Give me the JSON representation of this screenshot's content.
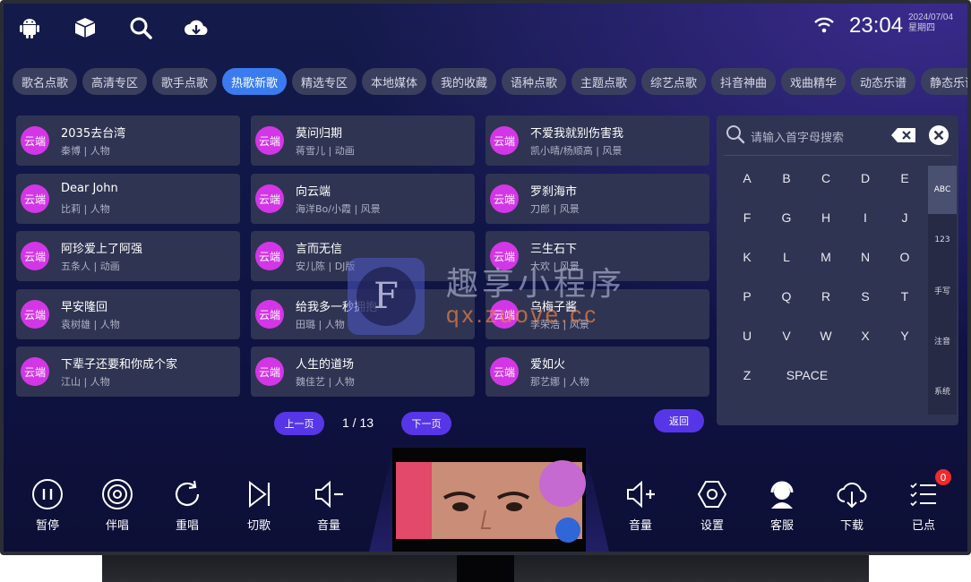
{
  "top_bar": {
    "icons": [
      "android-icon",
      "box-icon",
      "search-icon",
      "cloud-download-icon"
    ],
    "time": "23:04",
    "date_line1": "2024/07/04",
    "date_line2": "星期四"
  },
  "tabs": [
    "歌名点歌",
    "高清专区",
    "歌手点歌",
    "热歌新歌",
    "精选专区",
    "本地媒体",
    "我的收藏",
    "语种点歌",
    "主题点歌",
    "综艺点歌",
    "抖音神曲",
    "戏曲精华",
    "动态乐谱",
    "静态乐谱"
  ],
  "active_tab": "热歌新歌",
  "songs": [
    {
      "badge": "云端",
      "title": "2035去台湾",
      "sub": "秦博 | 人物"
    },
    {
      "badge": "云端",
      "title": "莫问归期",
      "sub": "蒋雪儿 | 动画"
    },
    {
      "badge": "云端",
      "title": "不爱我就别伤害我",
      "sub": "凯小晴/杨顺高 | 风景"
    },
    {
      "badge": "云端",
      "title": "Dear John",
      "sub": "比莉 | 人物"
    },
    {
      "badge": "云端",
      "title": "向云端",
      "sub": "海洋Bo/小霞 | 风景"
    },
    {
      "badge": "云端",
      "title": "罗刹海市",
      "sub": "刀郎 | 风景"
    },
    {
      "badge": "云端",
      "title": "阿珍爱上了阿强",
      "sub": "五条人 | 动画"
    },
    {
      "badge": "云端",
      "title": "言而无信",
      "sub": "安儿陈 | DJ版"
    },
    {
      "badge": "云端",
      "title": "三生石下",
      "sub": "大欢 | 风景"
    },
    {
      "badge": "云端",
      "title": "早安隆回",
      "sub": "袁树雄 | 人物"
    },
    {
      "badge": "云端",
      "title": "给我多一秒拥抱",
      "sub": "田璐 | 人物"
    },
    {
      "badge": "云端",
      "title": "乌梅子酱",
      "sub": "李荣浩 | 风景"
    },
    {
      "badge": "云端",
      "title": "下辈子还要和你成个家",
      "sub": "江山 | 人物"
    },
    {
      "badge": "云端",
      "title": "人生的道场",
      "sub": "魏佳艺 | 人物"
    },
    {
      "badge": "云端",
      "title": "爱如火",
      "sub": "那艺娜 | 人物"
    }
  ],
  "pagination": {
    "prev": "上一页",
    "indicator": "1 / 13",
    "next": "下一页",
    "back": "返回"
  },
  "keyboard": {
    "placeholder": "请输入首字母搜索",
    "keys": [
      "A",
      "B",
      "C",
      "D",
      "E",
      "F",
      "G",
      "H",
      "I",
      "J",
      "K",
      "L",
      "M",
      "N",
      "O",
      "P",
      "Q",
      "R",
      "S",
      "T",
      "U",
      "V",
      "W",
      "X",
      "Y",
      "Z"
    ],
    "space": "SPACE",
    "modes": [
      "ABC",
      "123",
      "手写",
      "注音",
      "系统"
    ],
    "active_mode": "ABC"
  },
  "controls_left": [
    {
      "icon": "pause-icon",
      "label": "暂停"
    },
    {
      "icon": "disc-icon",
      "label": "伴唱"
    },
    {
      "icon": "replay-icon",
      "label": "重唱"
    },
    {
      "icon": "skip-next-icon",
      "label": "切歌"
    },
    {
      "icon": "volume-down-icon",
      "label": "音量"
    }
  ],
  "controls_right": [
    {
      "icon": "volume-up-icon",
      "label": "音量"
    },
    {
      "icon": "settings-icon",
      "label": "设置"
    },
    {
      "icon": "customer-service-icon",
      "label": "客服"
    },
    {
      "icon": "download-icon",
      "label": "下载"
    },
    {
      "icon": "playlist-icon",
      "label": "已点"
    }
  ],
  "queued_count": "0",
  "watermark": {
    "title": "趣享小程序",
    "url": "qx.zuove.cc",
    "logo_letter": "F"
  },
  "colors": {
    "accent": "#3a7cf0",
    "badge": "#d336e6",
    "pill": "#5736e8",
    "card": "#2f3452",
    "notify": "#f02a2a"
  }
}
